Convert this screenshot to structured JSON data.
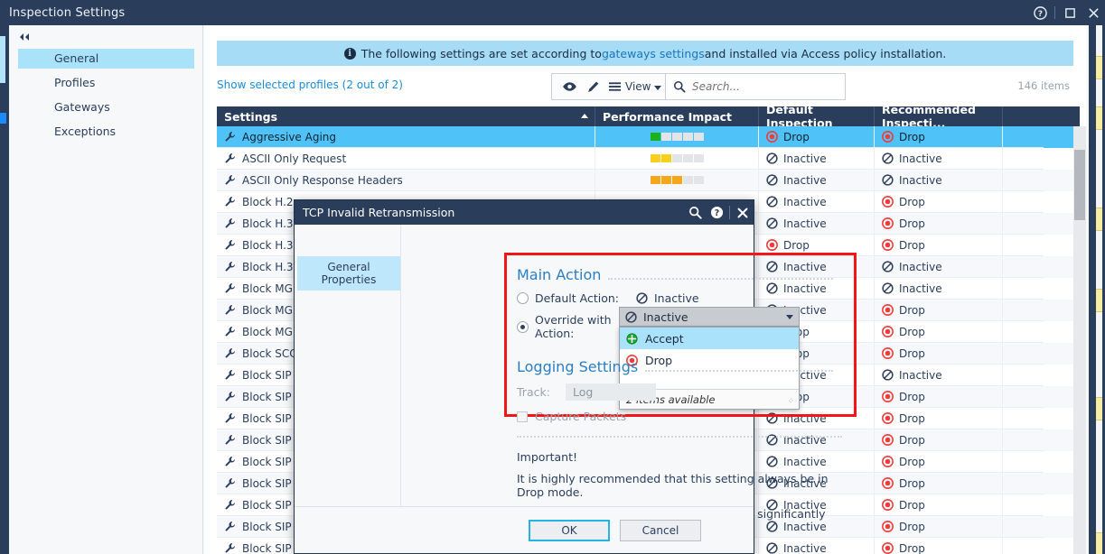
{
  "window": {
    "title": "Inspection Settings",
    "buttons": {
      "help": "?",
      "maximize": "□",
      "close": "✕"
    }
  },
  "sidebar": {
    "collapse_tooltip": "Collapse",
    "items": [
      {
        "label": "General",
        "active": true
      },
      {
        "label": "Profiles",
        "active": false
      },
      {
        "label": "Gateways",
        "active": false
      },
      {
        "label": "Exceptions",
        "active": false
      }
    ]
  },
  "infobar": {
    "prefix": "The following settings are set according to ",
    "link": "gateways settings",
    "suffix": " and installed via Access policy installation."
  },
  "toolbar": {
    "show_selected_profiles": "Show selected profiles (2 out of 2)",
    "view_label": "View",
    "search_placeholder": "Search...",
    "search_value": "",
    "item_count": "146 items"
  },
  "table": {
    "columns": [
      "Settings",
      "Performance Impact",
      "Default Inspection",
      "Recommended Inspecti...",
      ""
    ],
    "sort_column": "Settings",
    "sort_direction": "asc",
    "rows": [
      {
        "name": "Aggressive Aging",
        "impact": 1,
        "impact_color": "g",
        "default": "Drop",
        "recommended": "Drop",
        "selected": true
      },
      {
        "name": "ASCII Only Request",
        "impact": 2,
        "impact_color": "y",
        "default": "Inactive",
        "recommended": "Inactive",
        "selected": false
      },
      {
        "name": "ASCII Only Response Headers",
        "impact": 3,
        "impact_color": "o",
        "default": "Inactive",
        "recommended": "Inactive",
        "selected": false
      },
      {
        "name": "Block H.2",
        "impact": 0,
        "impact_color": "",
        "default": "Inactive",
        "recommended": "Drop",
        "selected": false
      },
      {
        "name": "Block H.3",
        "impact": 0,
        "impact_color": "",
        "default": "Inactive",
        "recommended": "Drop",
        "selected": false
      },
      {
        "name": "Block H.3",
        "impact": 0,
        "impact_color": "",
        "default": "Drop",
        "recommended": "Drop",
        "selected": false
      },
      {
        "name": "Block H.3",
        "impact": 0,
        "impact_color": "",
        "default": "Inactive",
        "recommended": "Inactive",
        "selected": false
      },
      {
        "name": "Block MG",
        "impact": 0,
        "impact_color": "",
        "default": "Inactive",
        "recommended": "Inactive",
        "selected": false
      },
      {
        "name": "Block MG",
        "impact": 0,
        "impact_color": "",
        "default": "Inactive",
        "recommended": "Drop",
        "selected": false
      },
      {
        "name": "Block MG",
        "impact": 0,
        "impact_color": "",
        "default": "Drop",
        "recommended": "Drop",
        "selected": false
      },
      {
        "name": "Block SCC",
        "impact": 0,
        "impact_color": "",
        "default": "Drop",
        "recommended": "Drop",
        "selected": false
      },
      {
        "name": "Block SIP",
        "impact": 0,
        "impact_color": "",
        "default": "Inactive",
        "recommended": "Inactive",
        "selected": false
      },
      {
        "name": "Block SIP",
        "impact": 0,
        "impact_color": "",
        "default": "Drop",
        "recommended": "Drop",
        "selected": false
      },
      {
        "name": "Block SIP",
        "impact": 0,
        "impact_color": "",
        "default": "Inactive",
        "recommended": "Drop",
        "selected": false
      },
      {
        "name": "Block SIP",
        "impact": 0,
        "impact_color": "",
        "default": "Inactive",
        "recommended": "Drop",
        "selected": false
      },
      {
        "name": "Block SIP",
        "impact": 0,
        "impact_color": "",
        "default": "Inactive",
        "recommended": "Drop",
        "selected": false
      },
      {
        "name": "Block SIP",
        "impact": 0,
        "impact_color": "",
        "default": "Inactive",
        "recommended": "Drop",
        "selected": false
      },
      {
        "name": "Block SIP",
        "impact": 0,
        "impact_color": "",
        "default": "Inactive",
        "recommended": "Drop",
        "selected": false
      },
      {
        "name": "Block SIP",
        "impact": 0,
        "impact_color": "",
        "default": "Inactive",
        "recommended": "Drop",
        "selected": false
      },
      {
        "name": "Block SIP Messages with Invalid Format in Start Line",
        "impact": 0,
        "impact_color": "",
        "default": "Inactive",
        "recommended": "Drop",
        "selected": false
      }
    ]
  },
  "dialog": {
    "title": "TCP Invalid Retransmission",
    "tab": "General Properties",
    "main_action": {
      "heading": "Main Action",
      "default_label": "Default Action:",
      "default_value": "Inactive",
      "override_label": "Override with Action:",
      "override_value": "Inactive",
      "selected": "override"
    },
    "dropdown": {
      "options": [
        {
          "label": "Accept",
          "icon": "accept-icon",
          "highlighted": true
        },
        {
          "label": "Drop",
          "icon": "drop-icon",
          "highlighted": false
        }
      ],
      "footer": "2 items available"
    },
    "logging": {
      "heading": "Logging Settings",
      "track_label": "Track:",
      "track_value": "Log",
      "capture_label": "Capture Packets",
      "capture_checked": false
    },
    "note": {
      "title": "Important!",
      "line1": "It is highly recommended that this setting always be in Drop mode.",
      "line2": "Using this protection in Accept mode may significantly lower security"
    },
    "buttons": {
      "ok": "OK",
      "cancel": "Cancel"
    }
  },
  "colors": {
    "header_navy": "#2a3e5c",
    "selection_blue": "#4fc3f7",
    "info_blue": "#a6dcf5",
    "link_blue": "#1a8cd8",
    "drop_red": "#f23b3b",
    "accept_green": "#19a832",
    "highlight_red": "#f21616"
  }
}
